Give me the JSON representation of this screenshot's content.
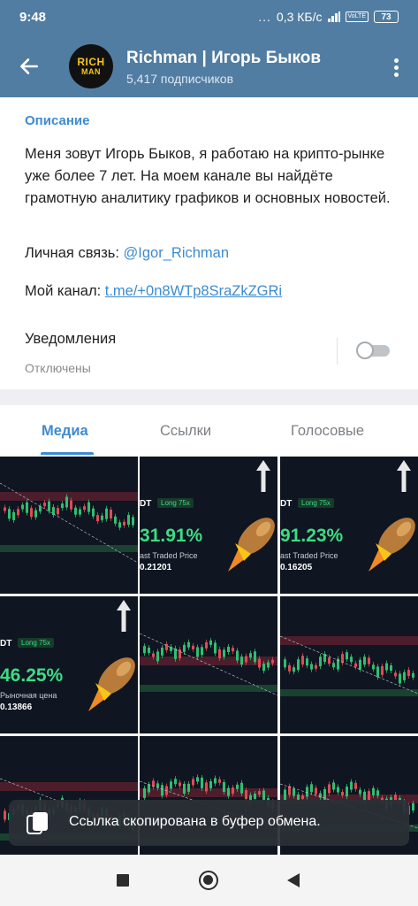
{
  "status_bar": {
    "time": "9:48",
    "dots": "...",
    "network_speed": "0,3 КБ/с",
    "network_type": "4G+",
    "volte": "VoLTE",
    "battery": "73"
  },
  "header": {
    "back_icon": "arrow-left-icon",
    "avatar_line1": "RICH",
    "avatar_line2": "MAN",
    "title": "Richman | Игорь Быков",
    "subtitle": "5,417 подписчиков",
    "menu_icon": "more-vert-icon"
  },
  "info": {
    "section_label": "Описание",
    "description": "Меня зовут Игорь Быков, я работаю на крипто-рынке уже более 7 лет. На моем канале вы найдёте грамотную аналитику графиков и основных новостей.",
    "contact_prefix": "Личная связь: ",
    "contact_handle": "@Igor_Richman",
    "channel_prefix": "Мой канал: ",
    "channel_link": "t.me/+0n8WTp8SraZkZGRi",
    "notifications_label": "Уведомления",
    "notifications_state": "Отключены",
    "notifications_enabled": false
  },
  "tabs": [
    {
      "label": "Медиа",
      "active": true
    },
    {
      "label": "Ссылки",
      "active": false
    },
    {
      "label": "Голосовые",
      "active": false
    }
  ],
  "media": [
    {
      "kind": "chart"
    },
    {
      "kind": "promo",
      "symbol": "DT",
      "leverage": "Long 75x",
      "percent": "31.91%",
      "price_label": "ast Traded Price",
      "price": "0.21201"
    },
    {
      "kind": "promo",
      "symbol": "DT",
      "leverage": "Long 75x",
      "percent": "91.23%",
      "price_label": "ast Traded Price",
      "price": "0.16205"
    },
    {
      "kind": "promo",
      "symbol": "DT",
      "leverage": "Long 75x",
      "percent": "46.25%",
      "price_label": "Рыночная цена",
      "price": "0.13866"
    },
    {
      "kind": "chart"
    },
    {
      "kind": "chart"
    },
    {
      "kind": "chart"
    },
    {
      "kind": "chart"
    },
    {
      "kind": "chart"
    }
  ],
  "toast": {
    "icon": "copy-icon",
    "text": "Ссылка скопирована в буфер обмена."
  },
  "nav_bar": {
    "recents_icon": "square-icon",
    "home_icon": "circle-home-icon",
    "back_icon": "triangle-back-icon"
  },
  "colors": {
    "header_bg": "#517da2",
    "accent": "#3d8bd0",
    "profit_green": "#3ddc84",
    "toast_bg": "#2c3036"
  }
}
